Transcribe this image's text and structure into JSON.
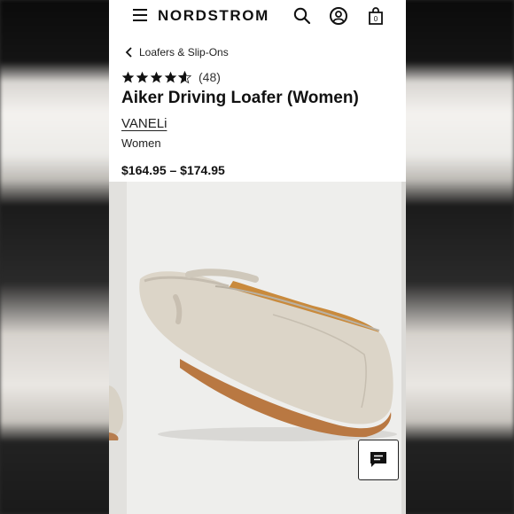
{
  "header": {
    "logo": "NORDSTROM",
    "menu_icon": "menu-icon",
    "search_icon": "search-icon",
    "account_icon": "account-icon",
    "bag_icon": "bag-icon",
    "bag_count": "0"
  },
  "breadcrumb": {
    "label": "Loafers & Slip-Ons",
    "icon": "chevron-left-icon"
  },
  "product": {
    "rating_stars": 4.5,
    "rating_count": "(48)",
    "title": "Aiker Driving Loafer (Women)",
    "brand": "VANELi",
    "gender": "Women",
    "price": "$164.95 – $174.95"
  },
  "gallery": {
    "image": "beige-leather-driving-loafer"
  },
  "chat": {
    "icon": "chat-icon"
  },
  "colors": {
    "text": "#111111",
    "shoe": "#d8d1c4",
    "sole": "#c7854f"
  }
}
